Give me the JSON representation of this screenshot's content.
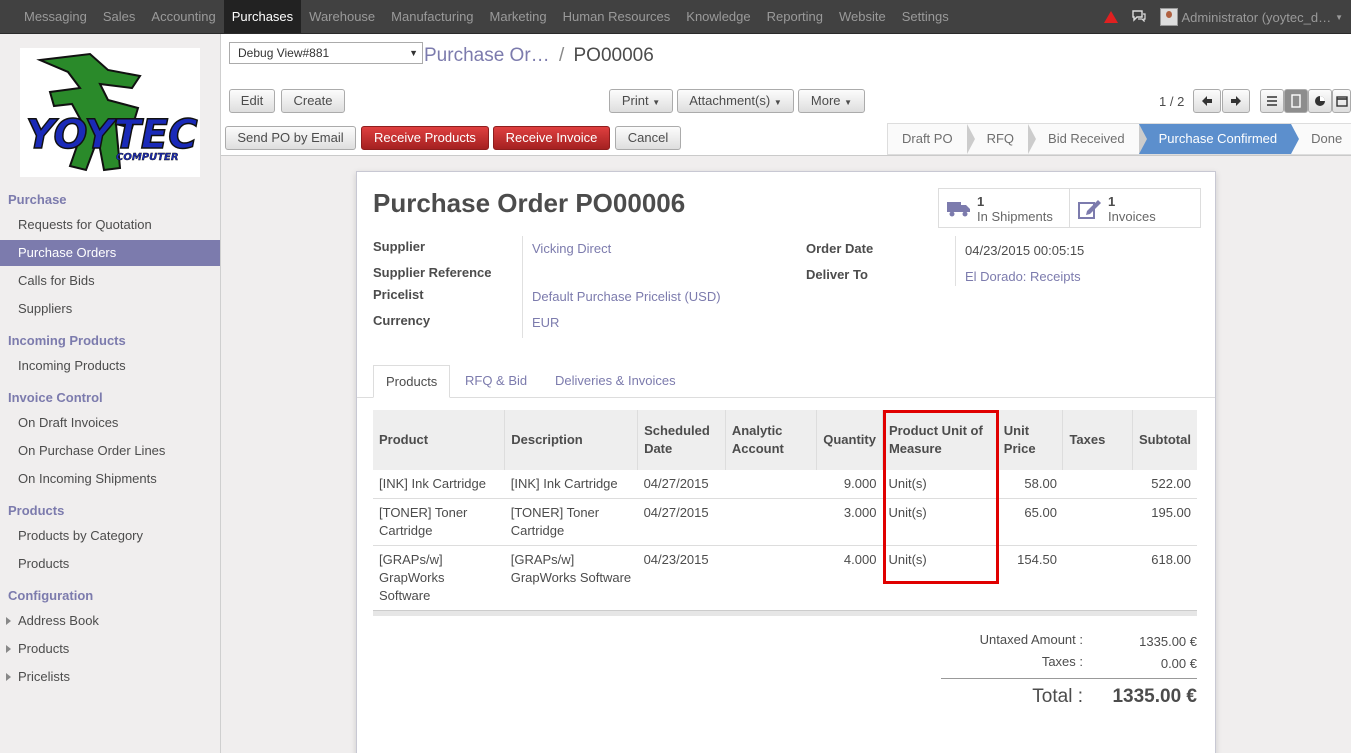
{
  "topbar": {
    "menu": [
      "Messaging",
      "Sales",
      "Accounting",
      "Purchases",
      "Warehouse",
      "Manufacturing",
      "Marketing",
      "Human Resources",
      "Knowledge",
      "Reporting",
      "Website",
      "Settings"
    ],
    "active_index": 3,
    "user": "Administrator (yoytec_d…"
  },
  "logo": {
    "text": "YOYTEC",
    "subtext": "COMPUTER"
  },
  "sidebar": {
    "sections": [
      {
        "title": "Purchase",
        "items": [
          "Requests for Quotation",
          "Purchase Orders",
          "Calls for Bids",
          "Suppliers"
        ]
      },
      {
        "title": "Incoming Products",
        "items": [
          "Incoming Products"
        ]
      },
      {
        "title": "Invoice Control",
        "items": [
          "On Draft Invoices",
          "On Purchase Order Lines",
          "On Incoming Shipments"
        ]
      },
      {
        "title": "Products",
        "items": [
          "Products by Category",
          "Products"
        ]
      },
      {
        "title": "Configuration",
        "items": [
          "Address Book",
          "Products",
          "Pricelists"
        ]
      }
    ],
    "active_item": "Purchase Orders"
  },
  "control": {
    "debug_select": "Debug View#881",
    "breadcrumb_parent": "Purchase Or…",
    "breadcrumb_sep": "/",
    "breadcrumb_current": "PO00006",
    "edit": "Edit",
    "create": "Create",
    "print": "Print",
    "attachments": "Attachment(s)",
    "more": "More",
    "pager": "1 / 2",
    "send_po": "Send PO by Email",
    "receive_products": "Receive Products",
    "receive_invoice": "Receive Invoice",
    "cancel": "Cancel",
    "stages": [
      "Draft PO",
      "RFQ",
      "Bid Received",
      "Purchase Confirmed",
      "Done"
    ],
    "active_stage": 3
  },
  "form": {
    "title_prefix": "Purchase Order",
    "title_number": "PO00006",
    "smart_buttons": [
      {
        "count": "1",
        "label": "In Shipments"
      },
      {
        "count": "1",
        "label": "Invoices"
      }
    ],
    "fields_left": [
      {
        "label": "Supplier",
        "value": "Vicking Direct"
      },
      {
        "label": "Supplier Reference",
        "value": ""
      },
      {
        "label": "Pricelist",
        "value": "Default Purchase Pricelist (USD)"
      },
      {
        "label": "Currency",
        "value": "EUR"
      }
    ],
    "fields_right": [
      {
        "label": "Order Date",
        "value": "04/23/2015 00:05:15"
      },
      {
        "label": "Deliver To",
        "value": "El Dorado: Receipts"
      }
    ],
    "tabs": [
      "Products",
      "RFQ & Bid",
      "Deliveries & Invoices"
    ],
    "columns": [
      "Product",
      "Description",
      "Scheduled Date",
      "Analytic Account",
      "Quantity",
      "Product Unit of Measure",
      "Unit Price",
      "Taxes",
      "Subtotal"
    ],
    "rows": [
      [
        "[INK] Ink Cartridge",
        "[INK] Ink Cartridge",
        "04/27/2015",
        "",
        "9.000",
        "Unit(s)",
        "58.00",
        "",
        "522.00"
      ],
      [
        "[TONER] Toner Cartridge",
        "[TONER] Toner Cartridge",
        "04/27/2015",
        "",
        "3.000",
        "Unit(s)",
        "65.00",
        "",
        "195.00"
      ],
      [
        "[GRAPs/w] GrapWorks Software",
        "[GRAPs/w] GrapWorks Software",
        "04/23/2015",
        "",
        "4.000",
        "Unit(s)",
        "154.50",
        "",
        "618.00"
      ]
    ],
    "totals": {
      "untaxed_label": "Untaxed Amount :",
      "untaxed_value": "1335.00 €",
      "taxes_label": "Taxes :",
      "taxes_value": "0.00 €",
      "total_label": "Total :",
      "total_value": "1335.00 €"
    }
  },
  "colors": {
    "accent": "#7c7bad",
    "topbar": "#414141",
    "stage_active": "#5c8fcd",
    "danger": "#c12a2a",
    "highlight": "#e00000"
  }
}
